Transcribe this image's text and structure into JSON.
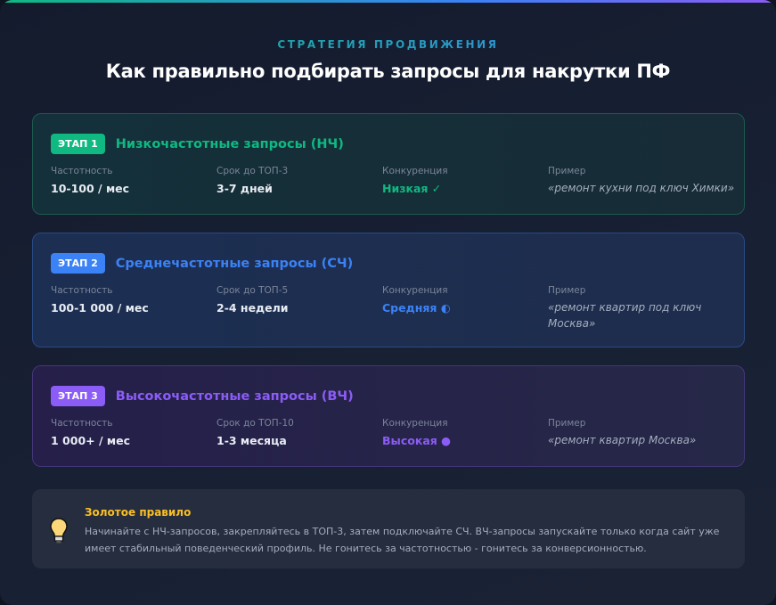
{
  "eyebrow": "СТРАТЕГИЯ ПРОДВИЖЕНИЯ",
  "title": "Как правильно подбирать запросы для накрутки ПФ",
  "colors": {
    "green": "#10b981",
    "blue": "#3b82f6",
    "purple": "#8b5cf6",
    "gold": "#fbbf24"
  },
  "stages": [
    {
      "badge": "ЭТАП 1",
      "title": "Низкочастотные запросы (НЧ)",
      "freq_label": "Частотность",
      "freq": "10-100 / мес",
      "term_label": "Срок до ТОП-3",
      "term": "3-7 дней",
      "comp_label": "Конкуренция",
      "comp": "Низкая ✓",
      "ex_label": "Пример",
      "ex": "«ремонт кухни под ключ Химки»"
    },
    {
      "badge": "ЭТАП 2",
      "title": "Среднечастотные запросы (СЧ)",
      "freq_label": "Частотность",
      "freq": "100-1 000 / мес",
      "term_label": "Срок до ТОП-5",
      "term": "2-4 недели",
      "comp_label": "Конкуренция",
      "comp": "Средняя ◐",
      "ex_label": "Пример",
      "ex": "«ремонт квартир под ключ Москва»"
    },
    {
      "badge": "ЭТАП 3",
      "title": "Высокочастотные запросы (ВЧ)",
      "freq_label": "Частотность",
      "freq": "1 000+ / мес",
      "term_label": "Срок до ТОП-10",
      "term": "1-3 месяца",
      "comp_label": "Конкуренция",
      "comp": "Высокая ●",
      "ex_label": "Пример",
      "ex": "«ремонт квартир Москва»"
    }
  ],
  "rule": {
    "title": "Золотое правило",
    "icon": "lightbulb-icon",
    "text": "Начинайте с НЧ-запросов, закрепляйтесь в ТОП-3, затем подключайте СЧ. ВЧ-запросы запускайте только когда сайт уже имеет стабильный поведенческий профиль. Не гонитесь за частотностью - гонитесь за конверсионностью."
  }
}
